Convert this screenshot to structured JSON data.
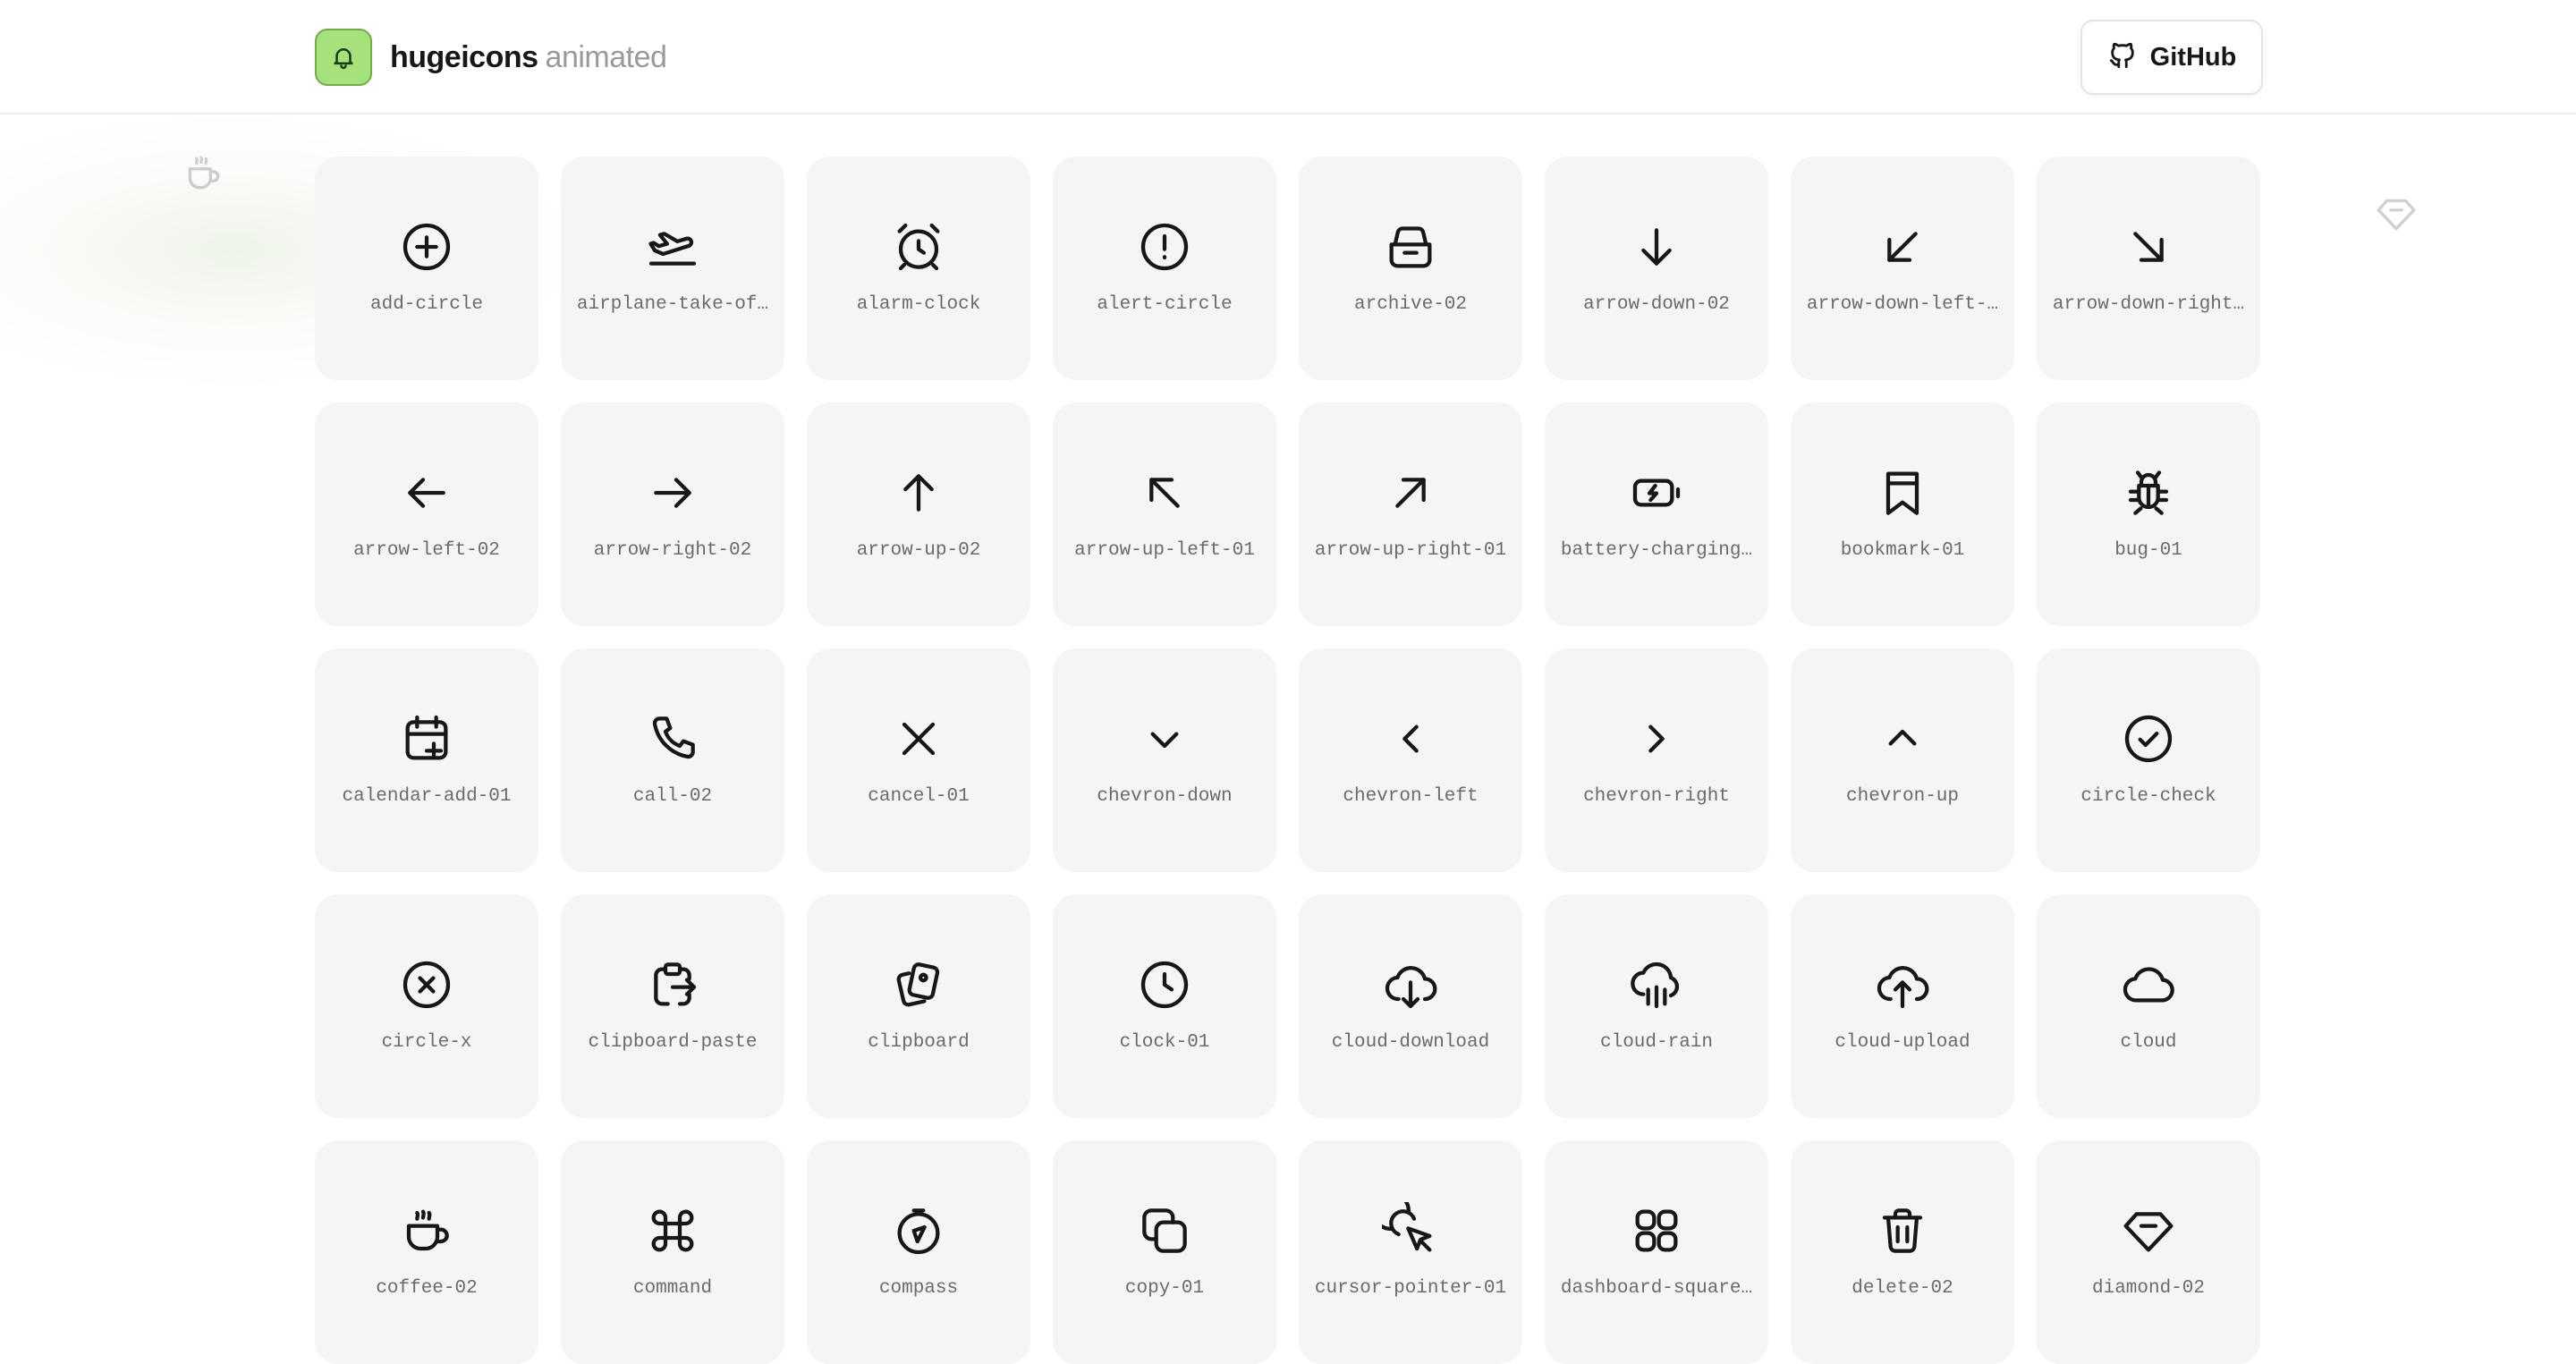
{
  "header": {
    "brand_name": "hugeicons",
    "brand_suffix": "animated",
    "logo_icon": "bell-icon",
    "github_label": "GitHub",
    "github_icon": "github-icon"
  },
  "background": {
    "floating_icons": [
      "coffee-icon",
      "diamond-icon"
    ]
  },
  "icons": [
    {
      "label": "add-circle",
      "icon": "add-circle"
    },
    {
      "label": "airplane-take-of…",
      "icon": "airplane"
    },
    {
      "label": "alarm-clock",
      "icon": "alarm-clock"
    },
    {
      "label": "alert-circle",
      "icon": "alert-circle"
    },
    {
      "label": "archive-02",
      "icon": "archive"
    },
    {
      "label": "arrow-down-02",
      "icon": "arrow-down"
    },
    {
      "label": "arrow-down-left-…",
      "icon": "arrow-down-left"
    },
    {
      "label": "arrow-down-right…",
      "icon": "arrow-down-right"
    },
    {
      "label": "arrow-left-02",
      "icon": "arrow-left"
    },
    {
      "label": "arrow-right-02",
      "icon": "arrow-right"
    },
    {
      "label": "arrow-up-02",
      "icon": "arrow-up"
    },
    {
      "label": "arrow-up-left-01",
      "icon": "arrow-up-left"
    },
    {
      "label": "arrow-up-right-01",
      "icon": "arrow-up-right"
    },
    {
      "label": "battery-charging…",
      "icon": "battery-charging"
    },
    {
      "label": "bookmark-01",
      "icon": "bookmark"
    },
    {
      "label": "bug-01",
      "icon": "bug"
    },
    {
      "label": "calendar-add-01",
      "icon": "calendar-add"
    },
    {
      "label": "call-02",
      "icon": "call"
    },
    {
      "label": "cancel-01",
      "icon": "cancel"
    },
    {
      "label": "chevron-down",
      "icon": "chevron-down"
    },
    {
      "label": "chevron-left",
      "icon": "chevron-left"
    },
    {
      "label": "chevron-right",
      "icon": "chevron-right"
    },
    {
      "label": "chevron-up",
      "icon": "chevron-up"
    },
    {
      "label": "circle-check",
      "icon": "circle-check"
    },
    {
      "label": "circle-x",
      "icon": "circle-x"
    },
    {
      "label": "clipboard-paste",
      "icon": "clipboard-paste"
    },
    {
      "label": "clipboard",
      "icon": "clipboard"
    },
    {
      "label": "clock-01",
      "icon": "clock"
    },
    {
      "label": "cloud-download",
      "icon": "cloud-download"
    },
    {
      "label": "cloud-rain",
      "icon": "cloud-rain"
    },
    {
      "label": "cloud-upload",
      "icon": "cloud-upload"
    },
    {
      "label": "cloud",
      "icon": "cloud"
    },
    {
      "label": "coffee-02",
      "icon": "coffee"
    },
    {
      "label": "command",
      "icon": "command"
    },
    {
      "label": "compass",
      "icon": "compass"
    },
    {
      "label": "copy-01",
      "icon": "copy"
    },
    {
      "label": "cursor-pointer-01",
      "icon": "cursor-pointer"
    },
    {
      "label": "dashboard-square…",
      "icon": "dashboard-square"
    },
    {
      "label": "delete-02",
      "icon": "delete"
    },
    {
      "label": "diamond-02",
      "icon": "diamond"
    }
  ]
}
